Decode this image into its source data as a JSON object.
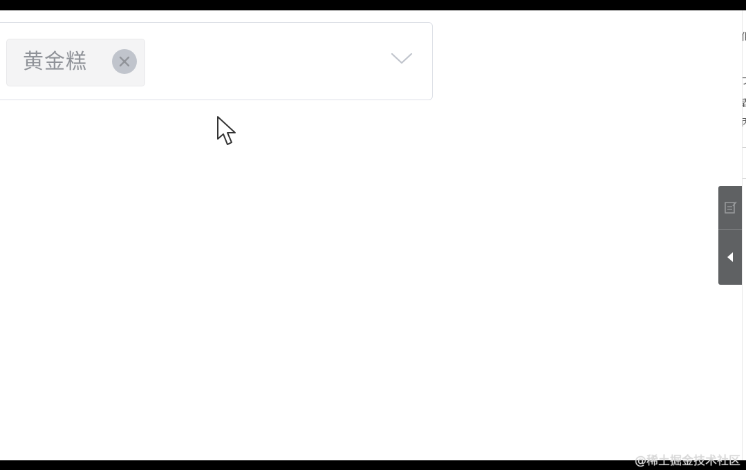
{
  "select": {
    "selected_tag": "黄金糕",
    "tag_close_icon": "circle-x-icon",
    "dropdown_icon": "chevron-down-icon"
  },
  "side_toolbar": {
    "edit_icon": "edit-note-icon",
    "collapse_icon": "caret-left-icon"
  },
  "watermark": "@稀土掘金技术社区",
  "colors": {
    "tag_bg": "#f4f4f5",
    "tag_text": "#909399",
    "border": "#dcdfe6",
    "toolbar_bg": "#5f6163"
  }
}
